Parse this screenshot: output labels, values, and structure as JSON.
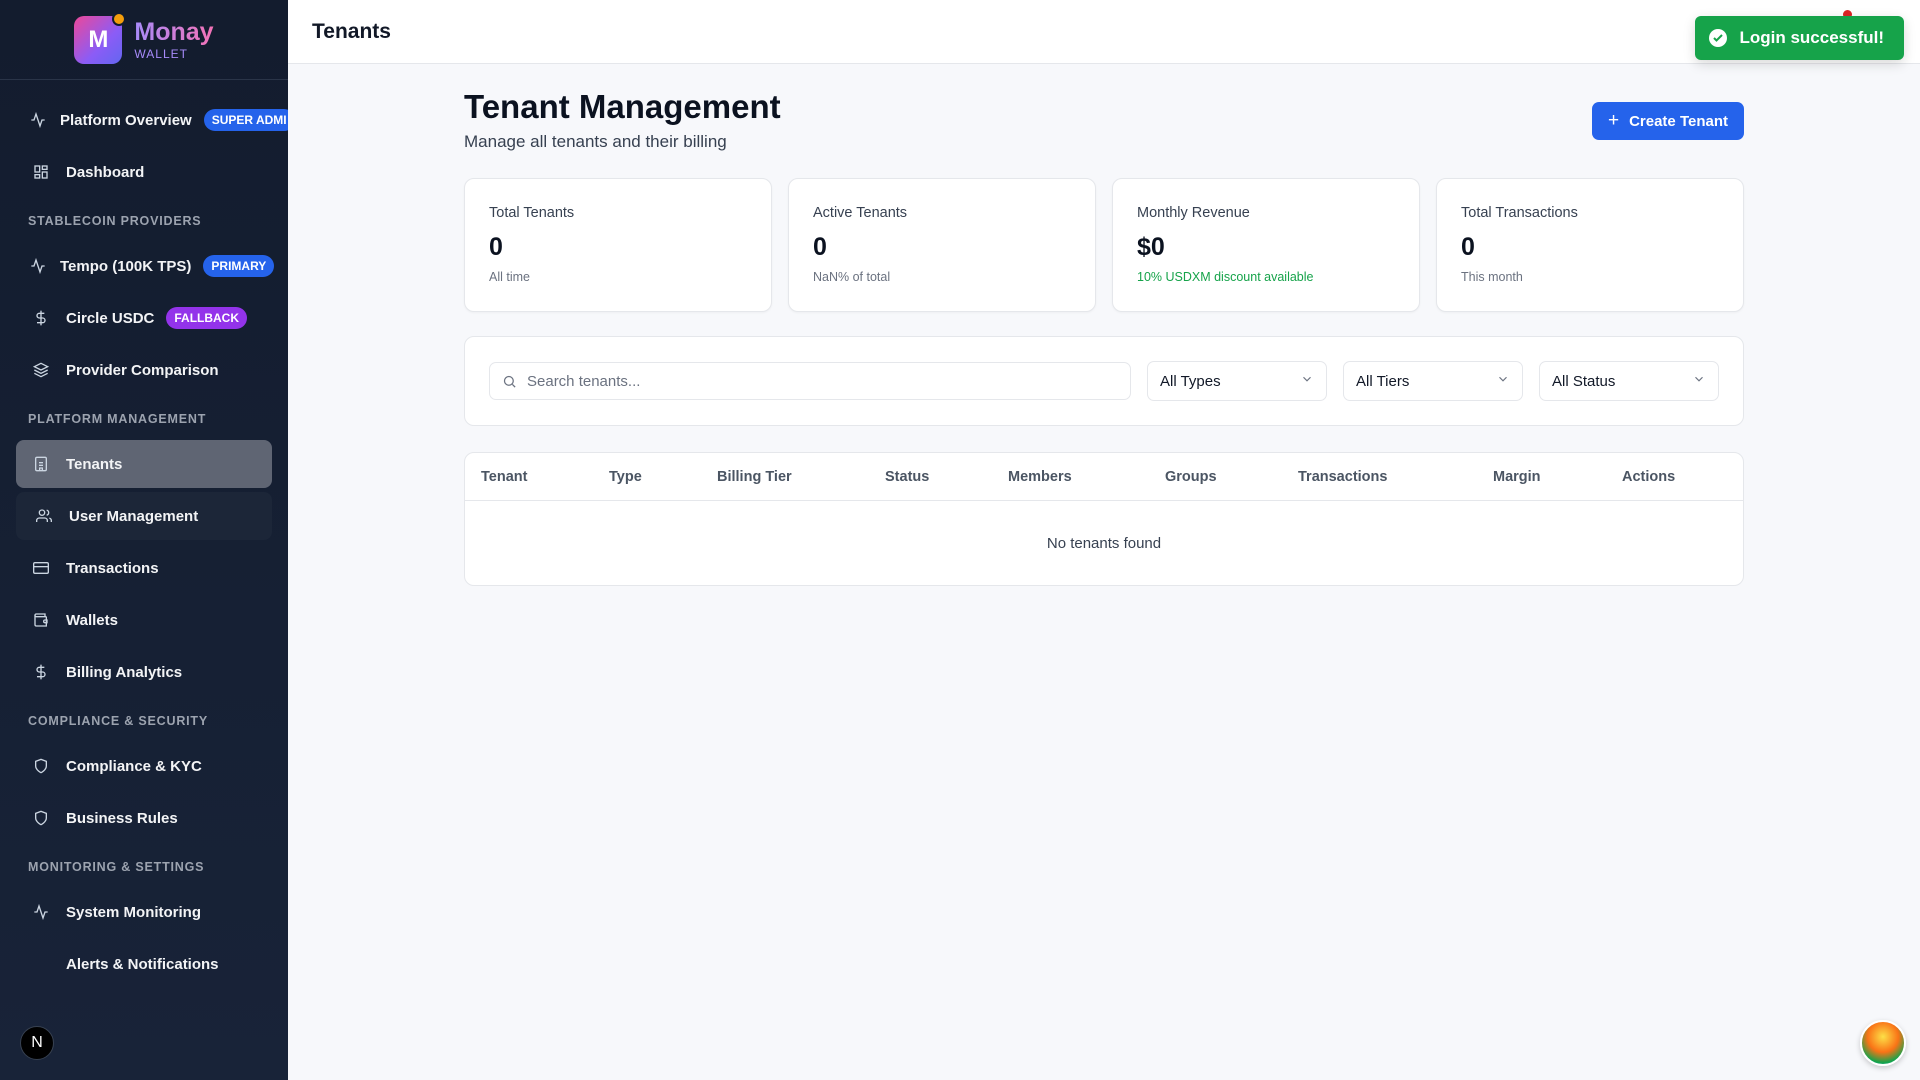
{
  "brand": {
    "logo_letter": "M",
    "name": "Monay",
    "sub": "WALLET"
  },
  "sidebar": {
    "items_top": [
      {
        "label": "Platform Overview",
        "icon": "activity-icon",
        "badge": "SUPER ADMI"
      },
      {
        "label": "Dashboard",
        "icon": "grid-icon"
      }
    ],
    "sections": [
      {
        "title": "STABLECOIN PROVIDERS",
        "items": [
          {
            "label": "Tempo (100K TPS)",
            "icon": "activity-icon",
            "badge": "PRIMARY"
          },
          {
            "label": "Circle USDC",
            "icon": "dollar-icon",
            "badge": "FALLBACK"
          },
          {
            "label": "Provider Comparison",
            "icon": "layers-icon"
          }
        ]
      },
      {
        "title": "PLATFORM MANAGEMENT",
        "items": [
          {
            "label": "Tenants",
            "icon": "building-icon"
          },
          {
            "label": "User Management",
            "icon": "users-icon"
          },
          {
            "label": "Transactions",
            "icon": "card-icon"
          },
          {
            "label": "Wallets",
            "icon": "wallet-icon"
          },
          {
            "label": "Billing Analytics",
            "icon": "dollar-icon"
          }
        ]
      },
      {
        "title": "COMPLIANCE & SECURITY",
        "items": [
          {
            "label": "Compliance & KYC",
            "icon": "shield-icon"
          },
          {
            "label": "Business Rules",
            "icon": "shield-icon"
          }
        ]
      },
      {
        "title": "MONITORING & SETTINGS",
        "items": [
          {
            "label": "System Monitoring",
            "icon": "activity-icon"
          },
          {
            "label": "Alerts & Notifications",
            "icon": "bell-icon"
          }
        ]
      }
    ],
    "next_logo": "N"
  },
  "topbar": {
    "title": "Tenants"
  },
  "toast": {
    "text": "Login successful!"
  },
  "header": {
    "title": "Tenant Management",
    "subtitle": "Manage all tenants and their billing",
    "create_label": "Create Tenant"
  },
  "stats": [
    {
      "label": "Total Tenants",
      "value": "0",
      "note": "All time"
    },
    {
      "label": "Active Tenants",
      "value": "0",
      "note": "NaN% of total"
    },
    {
      "label": "Monthly Revenue",
      "value": "$0",
      "note": "10% USDXM discount available"
    },
    {
      "label": "Total Transactions",
      "value": "0",
      "note": "This month"
    }
  ],
  "filters": {
    "search_placeholder": "Search tenants...",
    "type": "All Types",
    "tier": "All Tiers",
    "status": "All Status"
  },
  "table": {
    "columns": [
      "Tenant",
      "Type",
      "Billing Tier",
      "Status",
      "Members",
      "Groups",
      "Transactions",
      "Margin",
      "Actions"
    ],
    "empty_text": "No tenants found"
  },
  "colors": {
    "accent": "#2563eb",
    "sidebar_bg": "#162033",
    "success": "#16a34a",
    "primary_badge": "#2563eb",
    "fallback_badge": "#9333ea"
  }
}
